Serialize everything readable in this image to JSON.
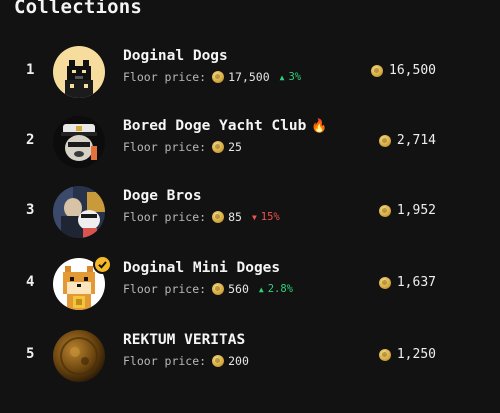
{
  "page": {
    "title": "Collections",
    "floor_label": "Floor price:"
  },
  "colors": {
    "background": "#121212",
    "up": "#2fd07a",
    "down": "#ef5350",
    "coin": "#d9ad45"
  },
  "collections": [
    {
      "rank": "1",
      "name": "Doginal Dogs",
      "badge": "",
      "floor": "17,500",
      "change": "3%",
      "trend": "up",
      "volume": "16,500",
      "avatar": "pixel-dog-avatar"
    },
    {
      "rank": "2",
      "name": "Bored Doge Yacht Club",
      "badge": "fire-icon",
      "floor": "25",
      "change": "",
      "trend": "",
      "volume": "2,714",
      "avatar": "captain-doge-avatar"
    },
    {
      "rank": "3",
      "name": "Doge Bros",
      "badge": "",
      "floor": "85",
      "change": "15%",
      "trend": "down",
      "volume": "1,952",
      "avatar": "doge-bros-avatar"
    },
    {
      "rank": "4",
      "name": "Doginal Mini Doges",
      "badge": "",
      "floor": "560",
      "change": "2.8%",
      "trend": "up",
      "volume": "1,637",
      "avatar": "mini-doge-avatar",
      "verified": true
    },
    {
      "rank": "5",
      "name": "REKTUM VERITAS",
      "badge": "",
      "floor": "200",
      "change": "",
      "trend": "",
      "volume": "1,250",
      "avatar": "rektum-coin-avatar"
    }
  ]
}
